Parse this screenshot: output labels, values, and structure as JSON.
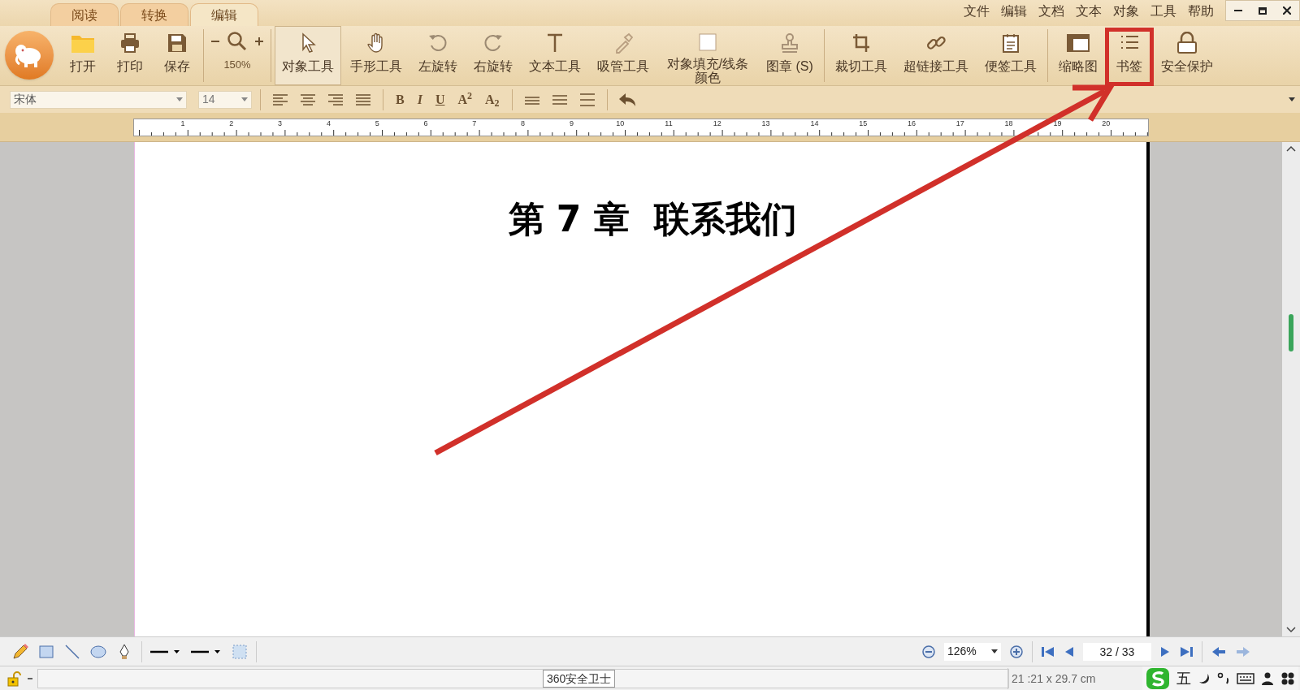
{
  "tabs": [
    {
      "label": "阅读",
      "selected": false
    },
    {
      "label": "转换",
      "selected": false
    },
    {
      "label": "编辑",
      "selected": true
    }
  ],
  "menu": [
    "文件",
    "编辑",
    "文档",
    "文本",
    "对象",
    "工具",
    "帮助"
  ],
  "toolbar": {
    "groups": [
      {
        "items": [
          {
            "label": "打开",
            "selected": false
          },
          {
            "label": "打印",
            "selected": false
          },
          {
            "label": "保存",
            "selected": false
          }
        ]
      },
      {
        "zoom": "150%"
      },
      {
        "items": [
          {
            "label": "对象工具",
            "selected": true
          },
          {
            "label": "手形工具",
            "selected": false
          },
          {
            "label": "左旋转",
            "selected": false
          },
          {
            "label": "右旋转",
            "selected": false
          },
          {
            "label": "文本工具",
            "selected": false
          },
          {
            "label": "吸管工具",
            "selected": false
          },
          {
            "label": "对象填充/线条颜色",
            "selected": false
          },
          {
            "label": "图章 (S)",
            "selected": false
          }
        ]
      },
      {
        "items": [
          {
            "label": "裁切工具",
            "selected": false
          },
          {
            "label": "超链接工具",
            "selected": false
          },
          {
            "label": "便签工具",
            "selected": false
          }
        ]
      },
      {
        "items": [
          {
            "label": "缩略图",
            "selected": false
          },
          {
            "label": "书签",
            "selected": false,
            "highlighted": true
          },
          {
            "label": "安全保护",
            "selected": false
          }
        ]
      }
    ]
  },
  "format_bar": {
    "font": "宋体",
    "size": "14",
    "styles": [
      "B",
      "I",
      "U",
      "A$^{2}$",
      "A$_{2}$"
    ]
  },
  "ruler": {
    "labels": [
      "1",
      "2",
      "3",
      "4",
      "5",
      "6",
      "7",
      "8",
      "9",
      "10",
      "11",
      "12",
      "13",
      "14",
      "15",
      "16",
      "17",
      "18",
      "19",
      "20"
    ]
  },
  "document": {
    "heading": "第 7 章  联系我们"
  },
  "nav_bar": {
    "zoom": "126%",
    "page": "32 / 33"
  },
  "status_bar": {
    "page_size": "21 :21 x 29.7 cm",
    "tray_tooltip": "360安全卫士",
    "ime_mode": "五"
  }
}
